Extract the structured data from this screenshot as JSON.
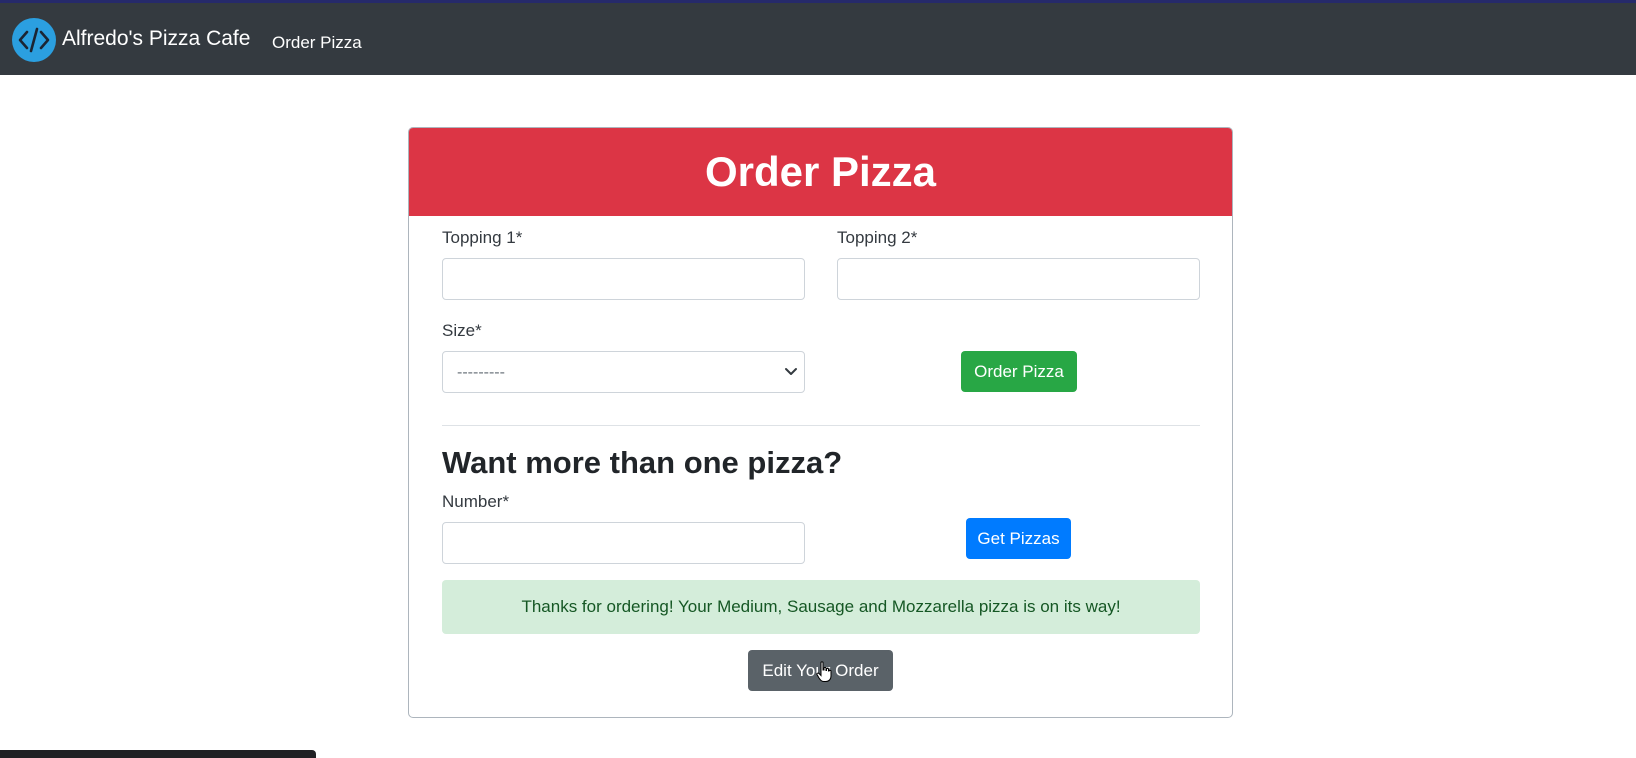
{
  "navbar": {
    "brand": "Alfredo's Pizza Cafe",
    "link": "Order Pizza",
    "logo_icon": "code-icon",
    "background": "#343a40"
  },
  "card": {
    "title": "Order Pizza",
    "header_color": "#dc3545",
    "topping1": {
      "label": "Topping 1*",
      "value": ""
    },
    "topping2": {
      "label": "Topping 2*",
      "value": ""
    },
    "size": {
      "label": "Size*",
      "selected": "---------"
    },
    "order_button": "Order Pizza",
    "multi_heading": "Want more than one pizza?",
    "number": {
      "label": "Number*",
      "value": ""
    },
    "get_button": "Get Pizzas",
    "alert_message": "Thanks for ordering! Your Medium, Sausage and Mozzarella pizza is on its way!",
    "edit_button": "Edit Your Order"
  },
  "colors": {
    "success": "#28a745",
    "primary": "#007bff",
    "secondary": "#5a6268",
    "alert_bg": "#d4edda"
  }
}
